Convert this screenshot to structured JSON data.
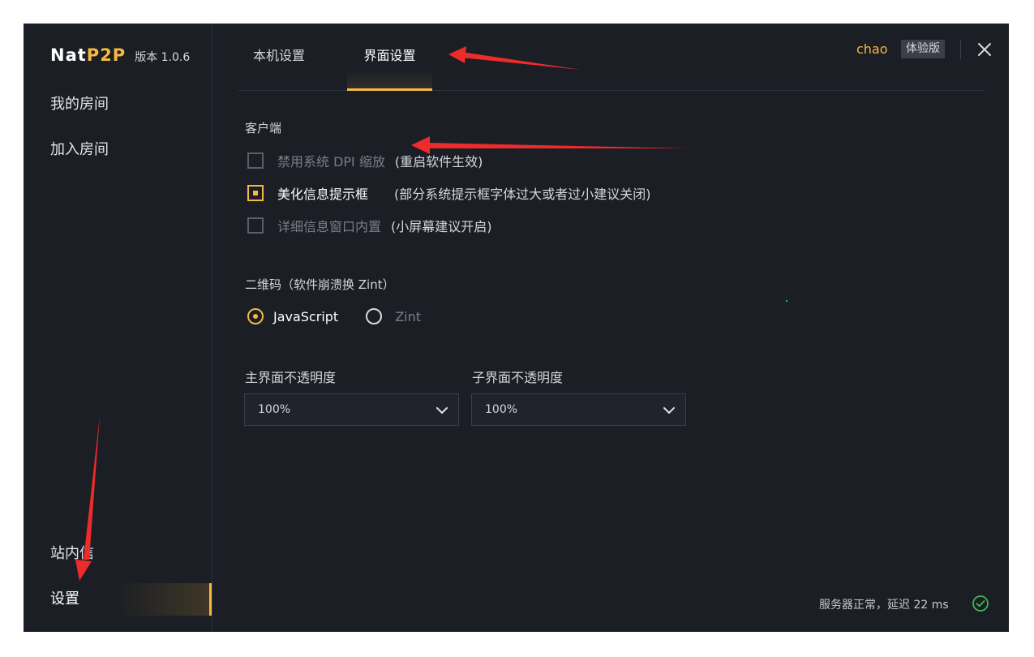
{
  "app": {
    "name_part1": "Nat",
    "name_part2": "P2P",
    "version": "版本 1.0.6",
    "accent_color": "#f5b941"
  },
  "sidebar": {
    "items": [
      {
        "label": "我的房间"
      },
      {
        "label": "加入房间"
      },
      {
        "label": "站内信"
      },
      {
        "label": "设置",
        "active": true
      }
    ]
  },
  "tabs": [
    {
      "label": "本机设置"
    },
    {
      "label": "界面设置",
      "active": true
    }
  ],
  "user": {
    "name": "chao",
    "badge": "体验版"
  },
  "client_section": {
    "title": "客户端",
    "options": [
      {
        "label": "禁用系统 DPI 缩放",
        "hint": "(重启软件生效)",
        "checked": false
      },
      {
        "label": "美化信息提示框",
        "hint": "(部分系统提示框字体过大或者过小建议关闭)",
        "checked": true
      },
      {
        "label": "详细信息窗口内置",
        "hint": "(小屏幕建议开启)",
        "checked": false
      }
    ]
  },
  "qrcode_section": {
    "title": "二维码（软件崩溃换 Zint）",
    "options": [
      {
        "label": "JavaScript",
        "selected": true
      },
      {
        "label": "Zint",
        "selected": false
      }
    ]
  },
  "opacity": {
    "main_label": "主界面不透明度",
    "main_value": "100%",
    "sub_label": "子界面不透明度",
    "sub_value": "100%"
  },
  "status": {
    "text": "服务器正常，延迟 22 ms",
    "color": "#3fb950"
  },
  "icons": {
    "close": "close-icon",
    "chevron": "chevron-down-icon",
    "status": "check-circle-icon"
  }
}
